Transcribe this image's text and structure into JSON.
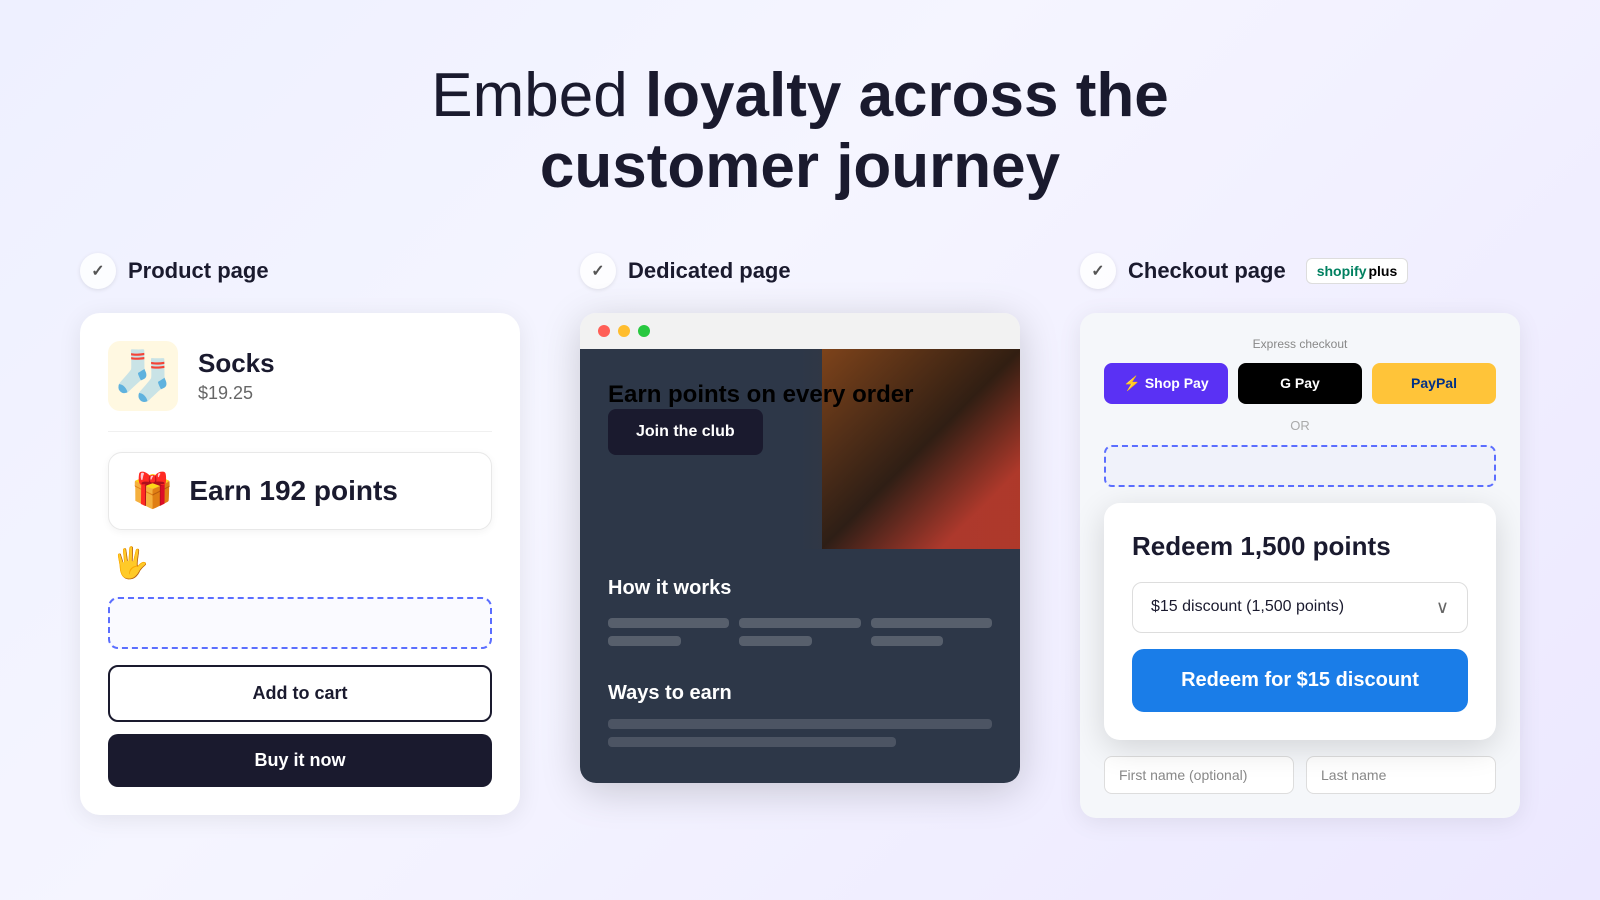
{
  "headline": {
    "part1": "Embed ",
    "part2": "loyalty across the",
    "part3": "customer journey"
  },
  "columns": [
    {
      "id": "product-page",
      "label": "Product page",
      "product": {
        "name": "Socks",
        "price": "$19.25",
        "earn_text": "Earn 192 points",
        "add_to_cart": "Add to cart",
        "buy_now": "Buy it now"
      }
    },
    {
      "id": "dedicated-page",
      "label": "Dedicated page",
      "hero_heading": "Earn points on every order",
      "join_label": "Join the club",
      "how_it_works": "How it works",
      "ways_to_earn": "Ways to earn"
    },
    {
      "id": "checkout-page",
      "label": "Checkout page",
      "shopify_plus": "shopify",
      "shopify_plus2": "plus",
      "express_checkout": "Express checkout",
      "or": "OR",
      "redeem": {
        "title": "Redeem 1,500 points",
        "discount_label": "$15 discount (1,500 points)",
        "redeem_btn": "Redeem for $15 discount"
      },
      "form": {
        "first_name": "First name (optional)",
        "last_name": "Last name"
      }
    }
  ]
}
